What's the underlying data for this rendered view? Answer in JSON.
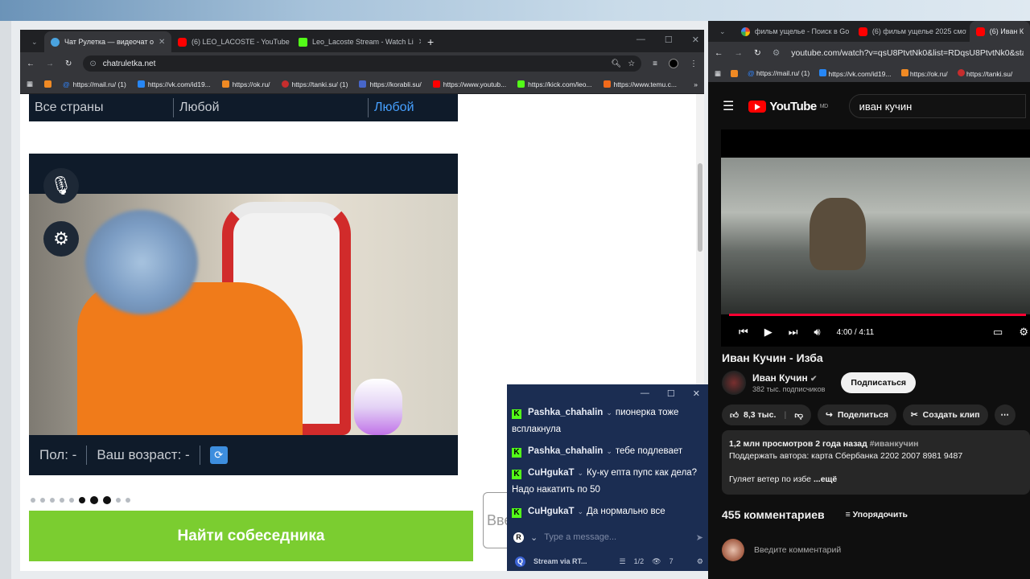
{
  "left_browser": {
    "tabs": [
      {
        "title": "Чат Рулетка — видеочат о",
        "active": true
      },
      {
        "title": "(6) LEO_LACOSTE - YouTube",
        "active": false
      },
      {
        "title": "Leo_Lacoste Stream - Watch Li",
        "active": false
      }
    ],
    "url": "chatruletka.net",
    "bookmarks": [
      "https://mail.ru/ (1)",
      "https://vk.com/id19...",
      "https://ok.ru/",
      "https://tanki.su/ (1)",
      "https://korabli.su/",
      "https://www.youtub...",
      "https://kick.com/leo...",
      "https://www.temu.c..."
    ]
  },
  "chatroulette": {
    "filter_country": "Все страны",
    "filter_any": "Любой",
    "filter_any_active": "Любой",
    "gender_label": "Пол: -",
    "age_label": "Ваш возраст: -",
    "find_button": "Найти собеседника",
    "message_placeholder": "Вве"
  },
  "kick_chat": {
    "messages": [
      {
        "user": "Pashka_chahalin",
        "text": "пионерка тоже всплакнула"
      },
      {
        "user": "Pashka_chahalin",
        "text": "тебе подлевает"
      },
      {
        "user": "CuHgukaT",
        "text": "Ку-ку епта пупс как дела? Надо накатить по 50"
      },
      {
        "user": "CuHgukaT",
        "text": "Да нормально все"
      }
    ],
    "input_placeholder": "Type a message...",
    "footer_source": "Stream via RT...",
    "footer_pages": "1/2",
    "footer_viewers": "7"
  },
  "right_browser": {
    "tabs": [
      "фильм ущелье - Поиск в Goog",
      "(6) фильм ущелье 2025 смотре",
      "(6) Иван К"
    ],
    "url": "youtube.com/watch?v=qsU8PtvtNk0&list=RDqsU8PtvtNk0&start_radio=",
    "bookmarks": [
      "https://mail.ru/ (1)",
      "https://vk.com/id19...",
      "https://ok.ru/",
      "https://tanki.su/"
    ]
  },
  "youtube": {
    "logo": "YouTube",
    "logo_sup": "MD",
    "search": "иван кучин",
    "time": "4:00 / 4:11",
    "progress": 0.972,
    "title": "Иван Кучин - Изба",
    "channel": "Иван Кучин",
    "subs": "382 тыс. подписчиков",
    "subscribe": "Подписаться",
    "likes": "8,3 тыс.",
    "share": "Поделиться",
    "clip": "Создать клип",
    "more": "⋯",
    "stats": "1,2 млн просмотров  2 года назад",
    "hashtag": "#иванкучин",
    "support": "Поддержать автора: карта Сбербанка 2202 2007 8981 9487",
    "desc_line": "Гуляет ветер по избе",
    "desc_more": "...ещё",
    "comments_count": "455 комментариев",
    "sort": "Упорядочить",
    "comment_placeholder": "Введите комментарий"
  }
}
